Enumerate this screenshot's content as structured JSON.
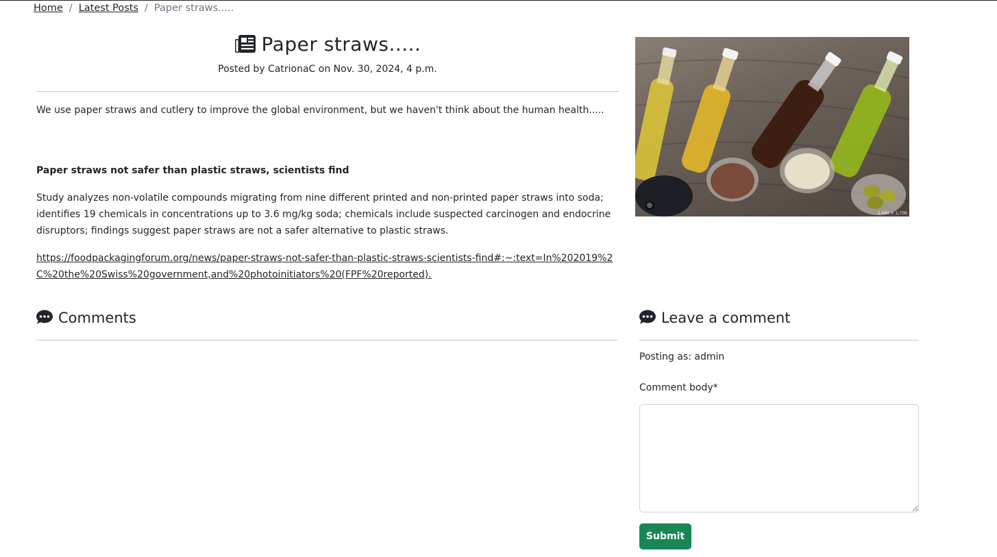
{
  "breadcrumb": {
    "home": "Home",
    "latest": "Latest Posts",
    "current": "Paper straws.....",
    "separator": "/"
  },
  "post": {
    "icon": "newspaper-icon",
    "title": "Paper straws.....",
    "meta": "Posted by CatrionaC on Nov. 30, 2024, 4 p.m.",
    "intro": "We use paper straws and cutlery to improve the global environment, but we haven't think about the human health.....",
    "subheading": "Paper straws not safer than plastic straws, scientists find",
    "body": "Study analyzes non-volatile compounds migrating from nine different printed and non-printed paper straws into soda; identifies 19 chemicals in concentrations up to 3.6 mg/kg soda; chemicals include suspected carcinogen and endocrine disruptors; findings suggest paper straws are not a safer alternative to plastic straws.",
    "link": "https://foodpackagingforum.org/news/paper-straws-not-safer-than-plastic-straws-scientists-find#:~:text=In%202019%2C%20the%20Swiss%20government,and%20photoinitiators%20(FPF%20reported)."
  },
  "image": {
    "badge": "2,680 × 1,700"
  },
  "comments": {
    "icon": "comment-dots-icon",
    "title": "Comments"
  },
  "form": {
    "icon": "comment-dots-icon",
    "title": "Leave a comment",
    "posting_as": "Posting as: admin",
    "body_label": "Comment body*",
    "submit": "Submit"
  },
  "colors": {
    "submit_bg": "#198754",
    "text": "#212529",
    "muted": "#6c757d"
  }
}
